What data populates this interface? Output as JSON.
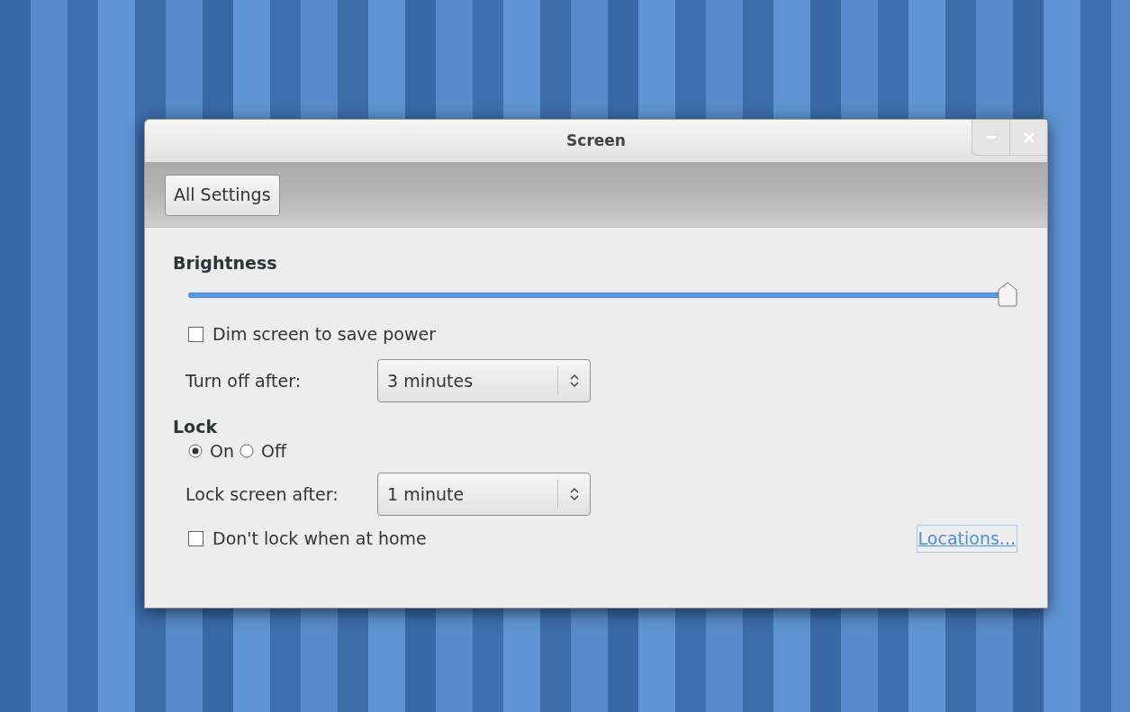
{
  "window": {
    "title": "Screen"
  },
  "toolbar": {
    "button": "All Settings"
  },
  "brightness": {
    "heading": "Brightness",
    "level": 1.0,
    "dim_option": {
      "label": "Dim screen to save power",
      "checked": false
    },
    "turn_off": {
      "label": "Turn off after:",
      "value": "3 minutes"
    }
  },
  "lock": {
    "heading": "Lock",
    "options": [
      {
        "label": "On",
        "selected": true
      },
      {
        "label": "Off",
        "selected": false
      }
    ],
    "lock_after": {
      "label": "Lock screen after:",
      "value": "1 minute"
    },
    "home_option": {
      "label": "Don't lock when at home",
      "checked": false
    },
    "link": "Locations..."
  }
}
